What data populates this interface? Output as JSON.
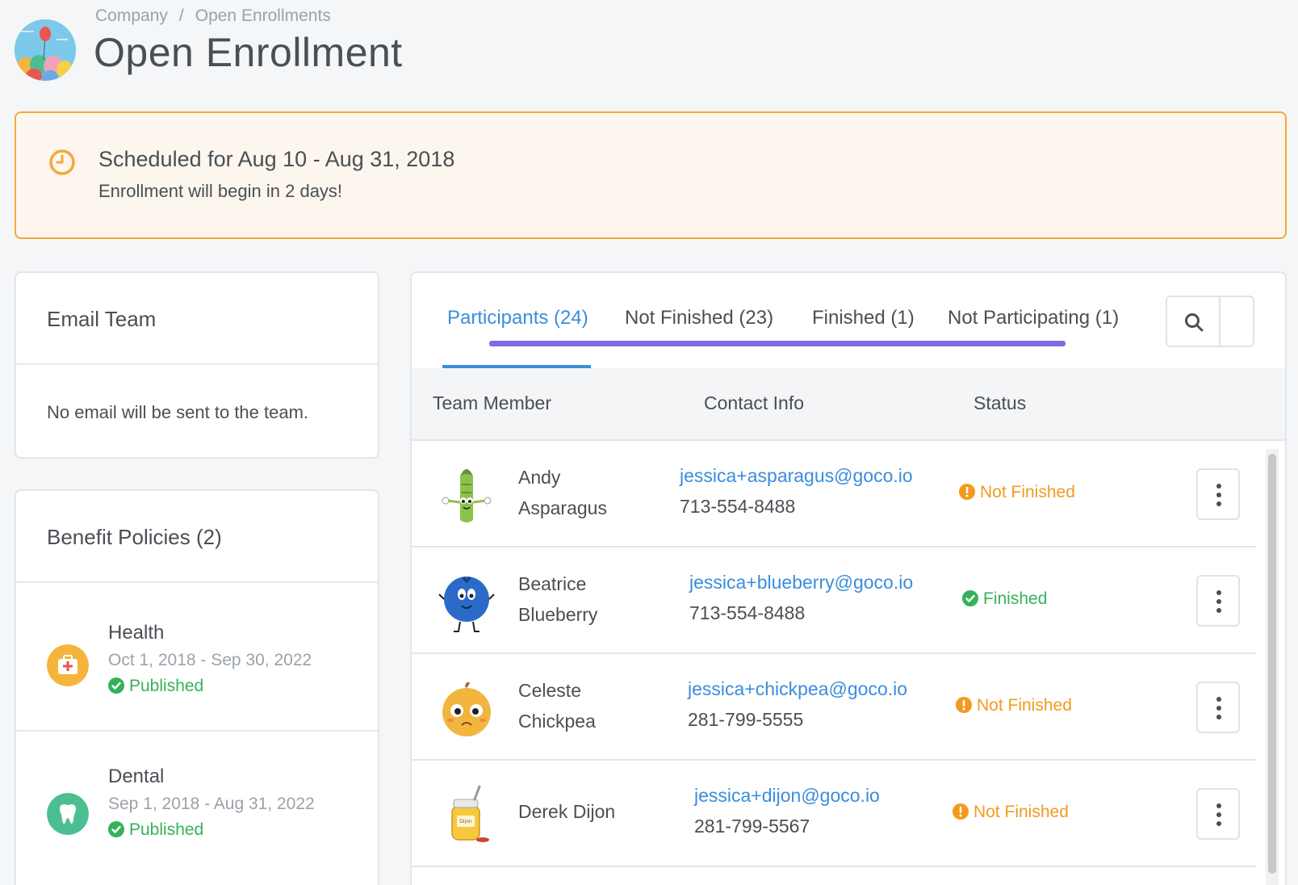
{
  "breadcrumb": {
    "items": [
      "Company",
      "Open Enrollments"
    ],
    "separator": "/"
  },
  "page": {
    "title": "Open Enrollment"
  },
  "alert": {
    "title": "Scheduled for Aug 10 - Aug 31, 2018",
    "subtitle": "Enrollment will begin in 2 days!",
    "icon": "clock-icon",
    "color": "#f3a93a"
  },
  "email_team": {
    "title": "Email Team",
    "message": "No email will be sent to the team."
  },
  "benefit_policies": {
    "title": "Benefit Policies (2)",
    "items": [
      {
        "name": "Health",
        "dates": "Oct 1, 2018 - Sep 30, 2022",
        "status": "Published",
        "icon": "first-aid-kit-icon",
        "color": "#f5b43c"
      },
      {
        "name": "Dental",
        "dates": "Sep 1, 2018 - Aug 31, 2022",
        "status": "Published",
        "icon": "tooth-icon",
        "color": "#4bbf91"
      }
    ]
  },
  "tabs": [
    {
      "label": "Participants (24)",
      "active": true
    },
    {
      "label": "Not Finished (23)",
      "active": false
    },
    {
      "label": "Finished (1)",
      "active": false
    },
    {
      "label": "Not Participating (1)",
      "active": false
    }
  ],
  "table": {
    "columns": [
      "Team Member",
      "Contact Info",
      "Status"
    ],
    "rows": [
      {
        "first": "Andy",
        "last": "Asparagus",
        "email": "jessica+asparagus@goco.io",
        "phone": "713-554-8488",
        "status": "Not Finished",
        "avatar": "asparagus-avatar"
      },
      {
        "first": "Beatrice",
        "last": "Blueberry",
        "email": "jessica+blueberry@goco.io",
        "phone": "713-554-8488",
        "status": "Finished",
        "avatar": "blueberry-avatar"
      },
      {
        "first": "Celeste",
        "last": "Chickpea",
        "email": "jessica+chickpea@goco.io",
        "phone": "281-799-5555",
        "status": "Not Finished",
        "avatar": "chickpea-avatar"
      },
      {
        "first": "Derek Dijon",
        "last": "",
        "email": "jessica+dijon@goco.io",
        "phone": "281-799-5567",
        "status": "Not Finished",
        "avatar": "dijon-avatar"
      }
    ]
  },
  "colors": {
    "accent": "#3a8ddc",
    "finished": "#35b259",
    "not_finished": "#f39a1d",
    "highlight": "#7b6be6"
  }
}
